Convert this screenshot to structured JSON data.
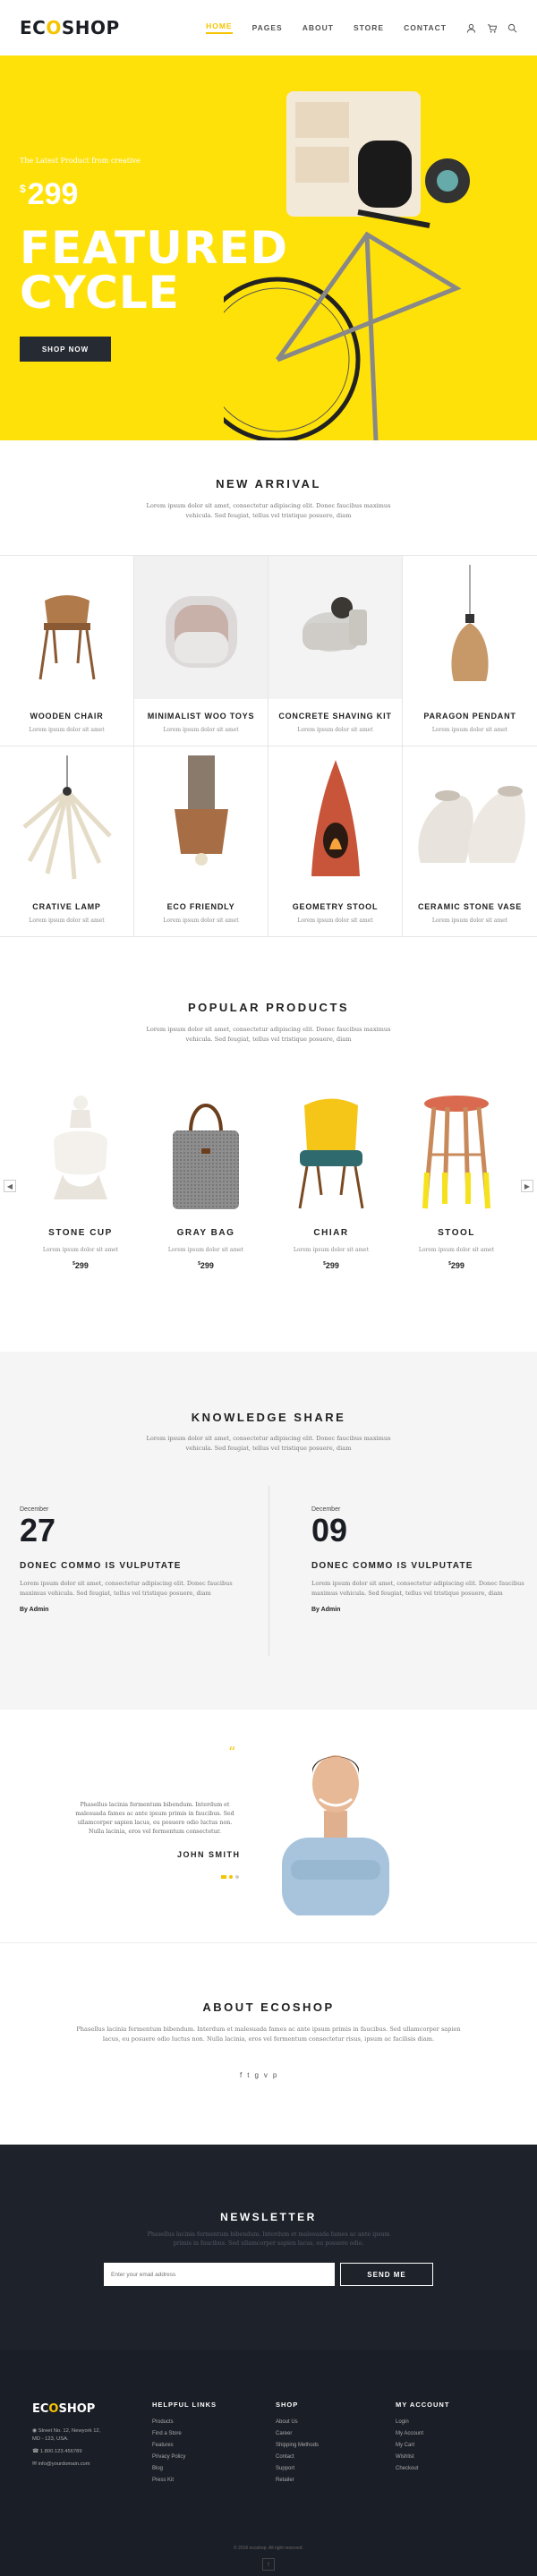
{
  "brand": {
    "logo_pre": "EC",
    "logo_o": "O",
    "logo_post": "SHOP"
  },
  "nav": {
    "items": [
      "HOME",
      "PAGES",
      "ABOUT",
      "STORE",
      "CONTACT"
    ],
    "active": "HOME"
  },
  "colors": {
    "accent": "#f5c400",
    "hero_bg": "#ffe10a",
    "dark": "#1e222b"
  },
  "hero": {
    "tagline": "The Latest Product from creative",
    "currency": "$",
    "price": "299",
    "title1": "FEATURED",
    "title2": "CYCLE",
    "button": "SHOP NOW"
  },
  "new_arrival": {
    "title": "NEW ARRIVAL",
    "desc": "Lorem ipsum dolor sit amet, consectetur adipiscing elit. Donec faucibus maximus vehicula. Sed feugiat, tellus vel tristique posuere, diam",
    "items": [
      {
        "name": "WOODEN CHAIR",
        "desc": "Lorem ipsum dolor sit amet"
      },
      {
        "name": "MINIMALIST WOO TOYS",
        "desc": "Lorem ipsum dolor sit amet"
      },
      {
        "name": "CONCRETE SHAVING KIT",
        "desc": "Lorem ipsum dolor sit amet"
      },
      {
        "name": "PARAGON PENDANT",
        "desc": "Lorem ipsum dolor sit amet"
      },
      {
        "name": "CRATIVE LAMP",
        "desc": "Lorem ipsum dolor sit amet"
      },
      {
        "name": "ECO FRIENDLY",
        "desc": "Lorem ipsum dolor sit amet"
      },
      {
        "name": "GEOMETRY STOOL",
        "desc": "Lorem ipsum dolor sit amet"
      },
      {
        "name": "CERAMIC STONE VASE",
        "desc": "Lorem ipsum dolor sit amet"
      }
    ]
  },
  "popular": {
    "title": "POPULAR PRODUCTS",
    "desc": "Lorem ipsum dolor sit amet, consectetur adipiscing elit. Donec faucibus maximus vehicula. Sed feugiat, tellus vel tristique posuere, diam",
    "items": [
      {
        "name": "STONE CUP",
        "desc": "Lorem ipsum dolor sit amet",
        "price": "299"
      },
      {
        "name": "GRAY BAG",
        "desc": "Lorem ipsum dolor sit amet",
        "price": "299"
      },
      {
        "name": "CHIAR",
        "desc": "Lorem ipsum dolor sit amet",
        "price": "299"
      },
      {
        "name": "STOOL",
        "desc": "Lorem ipsum dolor sit amet",
        "price": "299"
      }
    ]
  },
  "knowledge": {
    "title": "KNOWLEDGE SHARE",
    "desc": "Lorem ipsum dolor sit amet, consectetur adipiscing elit. Donec faucibus maximus vehicula. Sed feugiat, tellus vel tristique posuere, diam",
    "posts": [
      {
        "month": "December",
        "day": "27",
        "title": "DONEC COMMO IS VULPUTATE",
        "excerpt": "Lorem ipsum dolor sit amet, consectetur adipiscing elit. Donec faucibus maximus vehicula. Sed feugiat, tellus vel tristique posuere, diam",
        "author": "By Admin"
      },
      {
        "month": "December",
        "day": "09",
        "title": "DONEC COMMO IS VULPUTATE",
        "excerpt": "Lorem ipsum dolor sit amet, consectetur adipiscing elit. Donec faucibus maximus vehicula. Sed feugiat, tellus vel tristique posuere, diam",
        "author": "By Admin"
      }
    ]
  },
  "testimonial": {
    "quote": "Phasellus lacinia fermentum bibendum. Interdum et malesuada fames ac ante ipsum primis in faucibus. Sed ullamcorper sapien lacus, eu posuere odio luctus non. Nulla lacinia, eros vel fermentum consectetur.",
    "name": "JOHN SMITH"
  },
  "about": {
    "title": "ABOUT ECOSHOP",
    "desc": "Phasellus lacinia fermentum bibendum. Interdum et malesuada fames ac ante ipsum primis in faucibus. Sed ullamcorper sapien lacus, eu posuere odio luctus non. Nulla lacinia, eros vel fermentum consectetur risus, ipsum ac facilisis diam."
  },
  "newsletter": {
    "title": "NEWSLETTER",
    "desc": "Phasellus lacinia fermentum bibendum. Interdum et malesuada fames ac ante ipsum primis in faucibus. Sed ullamcorper sapien lacus, eu posuere odio.",
    "placeholder": "Enter your email address",
    "button": "SEND ME"
  },
  "footer": {
    "address": "Street No. 12, Newyork 12,",
    "address2": "MD - 123, USA.",
    "phone": "1.800.123.456789",
    "email": "info@yourdomain.com",
    "cols": [
      {
        "title": "HELPFUL LINKS",
        "links": [
          "Products",
          "Find a Store",
          "Features",
          "Privacy Policy",
          "Blog",
          "Press Kit"
        ]
      },
      {
        "title": "SHOP",
        "links": [
          "About Us",
          "Career",
          "Shipping Methods",
          "Contact",
          "Support",
          "Retailer"
        ]
      },
      {
        "title": "MY ACCOUNT",
        "links": [
          "Login",
          "My Account",
          "My Cart",
          "Wishlist",
          "Checkout"
        ]
      }
    ],
    "copyright": "© 2016 ecoshop. All right reserved."
  }
}
